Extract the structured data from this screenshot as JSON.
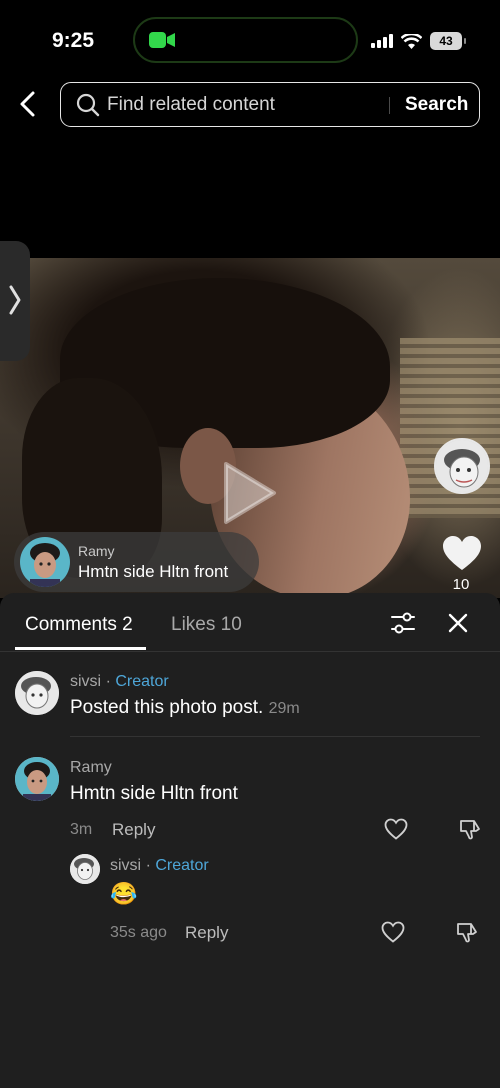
{
  "status_bar": {
    "time": "9:25",
    "battery": "43"
  },
  "search": {
    "placeholder": "Find related content",
    "button_label": "Search"
  },
  "post": {
    "author": "Ramy",
    "caption": "Hmtn side Hltn front",
    "like_count": "10"
  },
  "panel": {
    "tabs": [
      {
        "label": "Comments 2"
      },
      {
        "label": "Likes 10"
      }
    ],
    "comments": [
      {
        "author": "sivsi",
        "separator": "·",
        "badge": "Creator",
        "text": "Posted this photo post.",
        "time": "29m"
      },
      {
        "author": "Ramy",
        "text": "Hmtn side Hltn front",
        "time": "3m",
        "reply_label": "Reply",
        "replies": [
          {
            "author": "sivsi",
            "separator": "·",
            "badge": "Creator",
            "text": "😂",
            "time": "35s ago",
            "reply_label": "Reply"
          }
        ]
      }
    ]
  },
  "colors": {
    "accent_creator": "#4ea6d8",
    "facetime_green": "#32d74b"
  }
}
